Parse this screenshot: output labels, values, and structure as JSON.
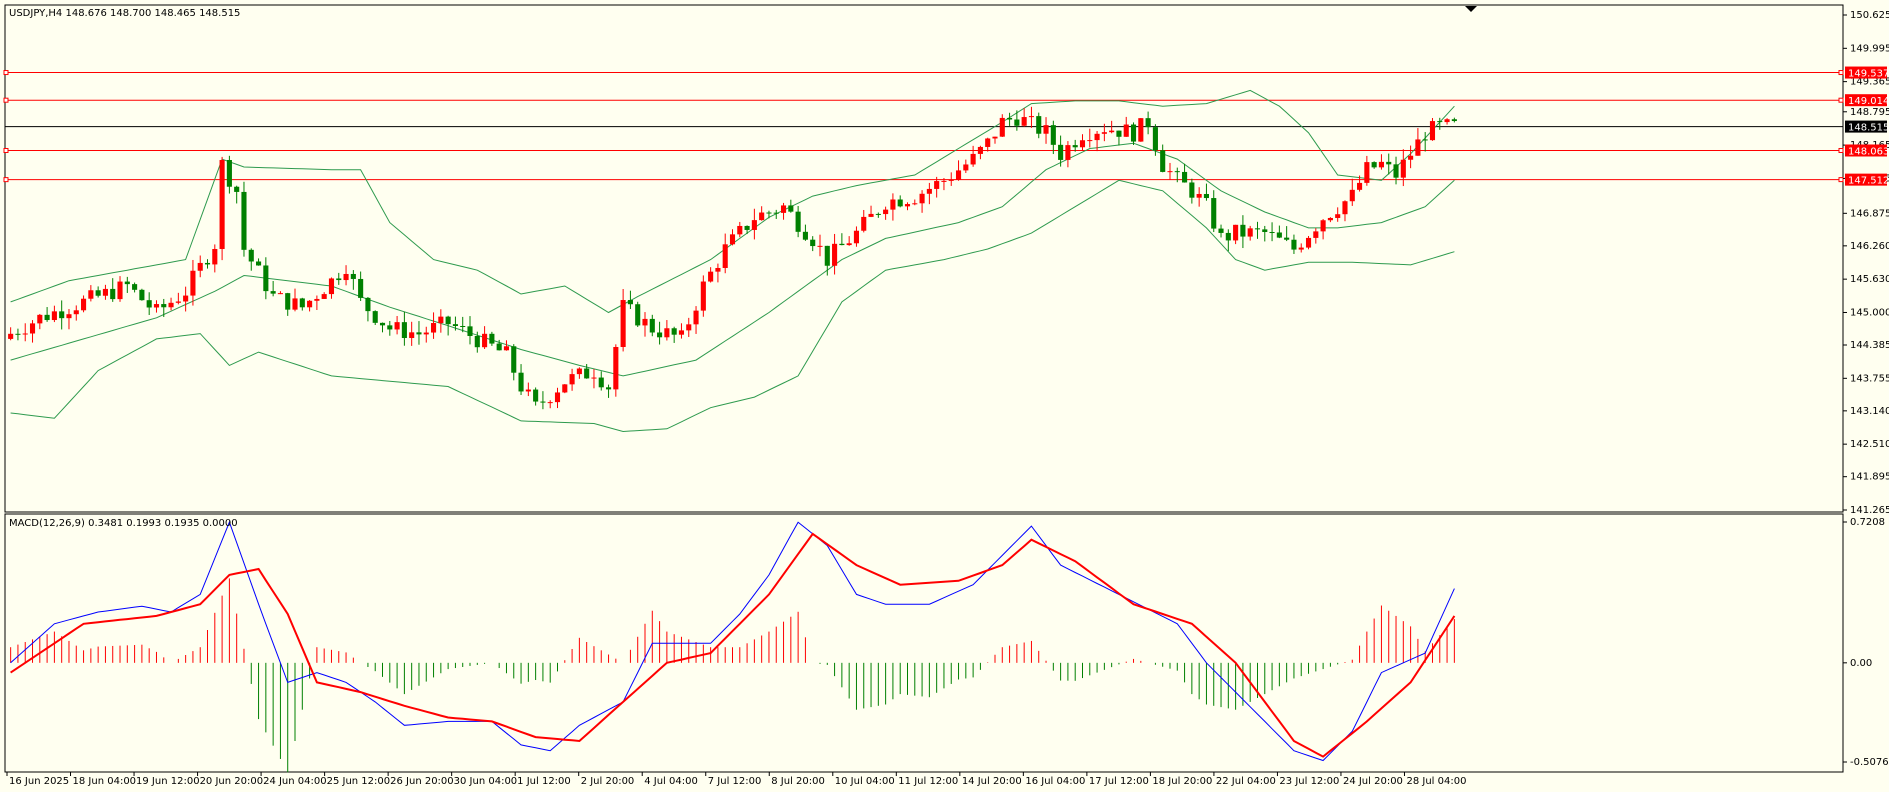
{
  "window": {
    "symbol_line": "USDJPY,H4  148.676 148.700 148.465 148.515",
    "indicator_line": "MACD(12,26,9) 0.3481 0.1993 0.1935 0.0000"
  },
  "colors": {
    "background": "#fffff0",
    "bull": "#ff0000",
    "bear": "#008000",
    "bands": "#2e9a4e",
    "level_line": "#ff0000",
    "price_line": "#000000",
    "macd_line": "#0000ff",
    "signal_line": "#ff0000",
    "hist_pos": "#ff0000",
    "hist_neg": "#008000"
  },
  "price_axis": {
    "ticks": [
      "150.625",
      "149.995",
      "149.365",
      "148.795",
      "148.165",
      "147.535",
      "146.875",
      "146.260",
      "145.630",
      "145.000",
      "144.385",
      "143.755",
      "143.140",
      "142.510",
      "141.895",
      "141.265"
    ],
    "tick_values": [
      150.625,
      149.995,
      149.365,
      148.795,
      148.165,
      147.535,
      146.875,
      146.26,
      145.63,
      145.0,
      144.385,
      143.755,
      143.14,
      142.51,
      141.895,
      141.265
    ],
    "min": 141.265,
    "max": 150.625
  },
  "levels": [
    {
      "label": "149.537",
      "value": 149.537
    },
    {
      "label": "149.014",
      "value": 149.014
    },
    {
      "label": "148.063",
      "value": 148.063
    },
    {
      "label": "147.512",
      "value": 147.512
    }
  ],
  "current_price": {
    "label": "148.515",
    "value": 148.515
  },
  "macd_axis": {
    "ticks": [
      "0.7208",
      "0.00",
      "-0.5076"
    ],
    "tick_values": [
      0.7208,
      0.0,
      -0.5076
    ],
    "max": 0.7208,
    "min": -0.5076
  },
  "time_axis": {
    "labels": [
      "16 Jun 2025",
      "18 Jun 04:00",
      "19 Jun 12:00",
      "20 Jun 20:00",
      "24 Jun 04:00",
      "25 Jun 12:00",
      "26 Jun 20:00",
      "30 Jun 04:00",
      "1 Jul 12:00",
      "2 Jul 20:00",
      "4 Jul 04:00",
      "7 Jul 12:00",
      "8 Jul 20:00",
      "10 Jul 04:00",
      "11 Jul 12:00",
      "14 Jul 20:00",
      "16 Jul 04:00",
      "17 Jul 12:00",
      "18 Jul 20:00",
      "22 Jul 04:00",
      "23 Jul 12:00",
      "24 Jul 20:00",
      "28 Jul 04:00"
    ]
  },
  "chart_data": {
    "type": "candlestick",
    "symbol": "USDJPY",
    "timeframe": "H4",
    "close_path": [
      [
        0,
        144.6
      ],
      [
        4,
        144.9
      ],
      [
        8,
        145.1
      ],
      [
        12,
        145.3
      ],
      [
        16,
        145.5
      ],
      [
        20,
        145.0
      ],
      [
        24,
        145.4
      ],
      [
        28,
        146.3
      ],
      [
        29,
        147.8
      ],
      [
        31,
        147.3
      ],
      [
        32,
        146.2
      ],
      [
        36,
        145.3
      ],
      [
        40,
        145.1
      ],
      [
        44,
        145.6
      ],
      [
        46,
        145.9
      ],
      [
        48,
        145.2
      ],
      [
        52,
        144.7
      ],
      [
        56,
        144.6
      ],
      [
        60,
        144.8
      ],
      [
        64,
        144.5
      ],
      [
        68,
        144.2
      ],
      [
        70,
        143.6
      ],
      [
        72,
        143.2
      ],
      [
        76,
        143.7
      ],
      [
        80,
        143.9
      ],
      [
        82,
        143.6
      ],
      [
        84,
        145.1
      ],
      [
        88,
        144.7
      ],
      [
        92,
        144.5
      ],
      [
        95,
        145.5
      ],
      [
        98,
        146.2
      ],
      [
        102,
        146.8
      ],
      [
        106,
        147.0
      ],
      [
        110,
        146.4
      ],
      [
        112,
        146.0
      ],
      [
        116,
        146.5
      ],
      [
        120,
        147.1
      ],
      [
        124,
        147.2
      ],
      [
        128,
        147.5
      ],
      [
        132,
        147.9
      ],
      [
        134,
        148.2
      ],
      [
        136,
        148.6
      ],
      [
        138,
        148.7
      ],
      [
        142,
        148.4
      ],
      [
        144,
        148.0
      ],
      [
        147,
        148.4
      ],
      [
        150,
        148.5
      ],
      [
        154,
        148.4
      ],
      [
        156,
        148.6
      ],
      [
        158,
        147.8
      ],
      [
        160,
        147.5
      ],
      [
        162,
        147.3
      ],
      [
        164,
        147.0
      ],
      [
        166,
        146.4
      ],
      [
        168,
        146.5
      ],
      [
        172,
        146.5
      ],
      [
        176,
        146.2
      ],
      [
        178,
        146.5
      ],
      [
        180,
        146.8
      ],
      [
        184,
        147.2
      ],
      [
        186,
        147.7
      ],
      [
        188,
        147.8
      ],
      [
        190,
        147.6
      ],
      [
        192,
        148.0
      ],
      [
        194,
        148.4
      ],
      [
        196,
        148.5
      ],
      [
        198,
        148.515
      ]
    ],
    "bands_upper": [
      [
        0,
        145.2
      ],
      [
        8,
        145.6
      ],
      [
        16,
        145.8
      ],
      [
        24,
        146.0
      ],
      [
        29,
        147.9
      ],
      [
        32,
        147.75
      ],
      [
        44,
        147.7
      ],
      [
        48,
        147.7
      ],
      [
        52,
        146.7
      ],
      [
        58,
        146.0
      ],
      [
        64,
        145.8
      ],
      [
        70,
        145.35
      ],
      [
        76,
        145.5
      ],
      [
        82,
        145.0
      ],
      [
        86,
        145.3
      ],
      [
        96,
        146.0
      ],
      [
        104,
        146.8
      ],
      [
        110,
        147.2
      ],
      [
        116,
        147.4
      ],
      [
        124,
        147.6
      ],
      [
        130,
        148.1
      ],
      [
        136,
        148.6
      ],
      [
        140,
        148.95
      ],
      [
        146,
        149.0
      ],
      [
        152,
        149.0
      ],
      [
        158,
        148.9
      ],
      [
        164,
        148.95
      ],
      [
        170,
        149.2
      ],
      [
        174,
        148.9
      ],
      [
        178,
        148.4
      ],
      [
        182,
        147.6
      ],
      [
        188,
        147.5
      ],
      [
        192,
        148.0
      ],
      [
        198,
        148.9
      ]
    ],
    "bands_middle": [
      [
        0,
        144.1
      ],
      [
        10,
        144.5
      ],
      [
        20,
        144.9
      ],
      [
        28,
        145.4
      ],
      [
        32,
        145.7
      ],
      [
        44,
        145.5
      ],
      [
        52,
        145.1
      ],
      [
        60,
        144.75
      ],
      [
        70,
        144.3
      ],
      [
        78,
        144.0
      ],
      [
        84,
        143.8
      ],
      [
        94,
        144.1
      ],
      [
        104,
        145.0
      ],
      [
        114,
        146.0
      ],
      [
        120,
        146.4
      ],
      [
        130,
        146.7
      ],
      [
        136,
        147.0
      ],
      [
        142,
        147.7
      ],
      [
        148,
        148.1
      ],
      [
        154,
        148.2
      ],
      [
        160,
        147.9
      ],
      [
        166,
        147.3
      ],
      [
        172,
        146.9
      ],
      [
        178,
        146.6
      ],
      [
        182,
        146.6
      ],
      [
        188,
        146.7
      ],
      [
        194,
        147.0
      ],
      [
        198,
        147.5
      ]
    ],
    "bands_lower": [
      [
        0,
        143.1
      ],
      [
        6,
        143.0
      ],
      [
        12,
        143.9
      ],
      [
        20,
        144.5
      ],
      [
        26,
        144.6
      ],
      [
        30,
        144.0
      ],
      [
        34,
        144.25
      ],
      [
        44,
        143.8
      ],
      [
        52,
        143.7
      ],
      [
        60,
        143.6
      ],
      [
        70,
        142.95
      ],
      [
        80,
        142.9
      ],
      [
        84,
        142.75
      ],
      [
        90,
        142.8
      ],
      [
        96,
        143.2
      ],
      [
        102,
        143.4
      ],
      [
        108,
        143.8
      ],
      [
        114,
        145.2
      ],
      [
        120,
        145.8
      ],
      [
        128,
        146.0
      ],
      [
        134,
        146.2
      ],
      [
        140,
        146.5
      ],
      [
        146,
        147.0
      ],
      [
        152,
        147.5
      ],
      [
        158,
        147.3
      ],
      [
        164,
        146.6
      ],
      [
        168,
        146.0
      ],
      [
        172,
        145.8
      ],
      [
        178,
        145.95
      ],
      [
        184,
        145.95
      ],
      [
        192,
        145.9
      ],
      [
        198,
        146.15
      ]
    ],
    "macd_path": [
      [
        0,
        0.0
      ],
      [
        6,
        0.2
      ],
      [
        12,
        0.26
      ],
      [
        18,
        0.29
      ],
      [
        22,
        0.26
      ],
      [
        26,
        0.35
      ],
      [
        30,
        0.72
      ],
      [
        34,
        0.3
      ],
      [
        38,
        -0.1
      ],
      [
        42,
        -0.05
      ],
      [
        46,
        -0.1
      ],
      [
        50,
        -0.2
      ],
      [
        54,
        -0.32
      ],
      [
        60,
        -0.3
      ],
      [
        66,
        -0.3
      ],
      [
        70,
        -0.42
      ],
      [
        74,
        -0.45
      ],
      [
        78,
        -0.32
      ],
      [
        84,
        -0.2
      ],
      [
        88,
        0.1
      ],
      [
        96,
        0.1
      ],
      [
        100,
        0.25
      ],
      [
        104,
        0.45
      ],
      [
        108,
        0.72
      ],
      [
        112,
        0.6
      ],
      [
        116,
        0.35
      ],
      [
        120,
        0.3
      ],
      [
        126,
        0.3
      ],
      [
        132,
        0.4
      ],
      [
        136,
        0.55
      ],
      [
        140,
        0.7
      ],
      [
        144,
        0.5
      ],
      [
        152,
        0.35
      ],
      [
        160,
        0.2
      ],
      [
        164,
        0.0
      ],
      [
        168,
        -0.15
      ],
      [
        172,
        -0.3
      ],
      [
        176,
        -0.45
      ],
      [
        180,
        -0.5
      ],
      [
        184,
        -0.35
      ],
      [
        188,
        -0.05
      ],
      [
        194,
        0.05
      ],
      [
        198,
        0.38
      ]
    ],
    "signal_path": [
      [
        0,
        -0.05
      ],
      [
        10,
        0.2
      ],
      [
        20,
        0.24
      ],
      [
        26,
        0.3
      ],
      [
        30,
        0.45
      ],
      [
        34,
        0.48
      ],
      [
        38,
        0.25
      ],
      [
        42,
        -0.1
      ],
      [
        48,
        -0.15
      ],
      [
        54,
        -0.22
      ],
      [
        60,
        -0.28
      ],
      [
        66,
        -0.3
      ],
      [
        72,
        -0.38
      ],
      [
        78,
        -0.4
      ],
      [
        84,
        -0.2
      ],
      [
        90,
        0.0
      ],
      [
        96,
        0.05
      ],
      [
        104,
        0.35
      ],
      [
        110,
        0.66
      ],
      [
        116,
        0.5
      ],
      [
        122,
        0.4
      ],
      [
        130,
        0.42
      ],
      [
        136,
        0.5
      ],
      [
        140,
        0.63
      ],
      [
        146,
        0.52
      ],
      [
        154,
        0.3
      ],
      [
        162,
        0.2
      ],
      [
        168,
        0.0
      ],
      [
        172,
        -0.2
      ],
      [
        176,
        -0.4
      ],
      [
        180,
        -0.48
      ],
      [
        186,
        -0.3
      ],
      [
        192,
        -0.1
      ],
      [
        198,
        0.24
      ]
    ]
  }
}
